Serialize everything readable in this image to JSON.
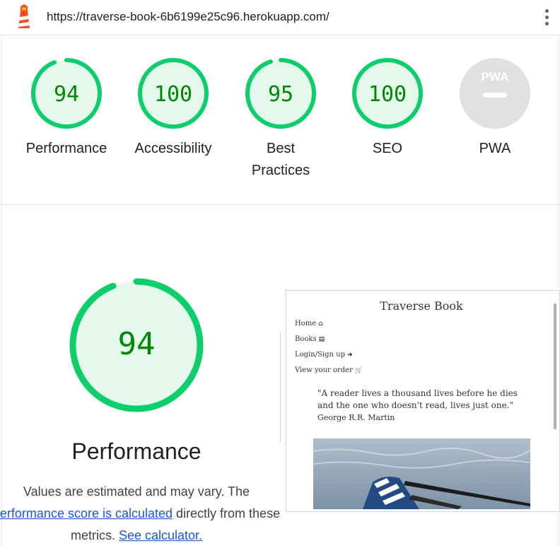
{
  "browser": {
    "url": "https://traverse-book-6b6199e25c96.herokuapp.com/"
  },
  "colors": {
    "pass": "#0cce6b",
    "pass_fill": "#e5f8ee",
    "pass_text": "#008800",
    "na_fill": "#e0e0e0"
  },
  "gauges": [
    {
      "score": "94",
      "label": "Performance",
      "status": "pass"
    },
    {
      "score": "100",
      "label": "Accessibility",
      "status": "pass"
    },
    {
      "score": "95",
      "label": "Best Practices",
      "status": "pass"
    },
    {
      "score": "100",
      "label": "SEO",
      "status": "pass"
    },
    {
      "score": "",
      "label": "PWA",
      "status": "na",
      "badge": "PWA"
    }
  ],
  "performance": {
    "score": "94",
    "title": "Performance",
    "desc_prefix": "Values are estimated and may vary. The ",
    "desc_link": "performance score is calculated",
    "desc_middle": " directly from these metrics. ",
    "desc_link2": "See calculator."
  },
  "screenshot": {
    "site_title": "Traverse Book",
    "nav": [
      {
        "label": "Home",
        "icon": "home-icon",
        "glyph": "⌂"
      },
      {
        "label": "Books",
        "icon": "book-icon",
        "glyph": "▤"
      },
      {
        "label": "Login/Sign up",
        "icon": "sign-in-icon",
        "glyph": "➜"
      },
      {
        "label": "View your order",
        "icon": "cart-icon",
        "glyph": "🛒"
      }
    ],
    "quote": "\"A reader lives a thousand lives before he dies and the one who doesn't read, lives just one.\"",
    "author": "George R.R. Martin"
  }
}
